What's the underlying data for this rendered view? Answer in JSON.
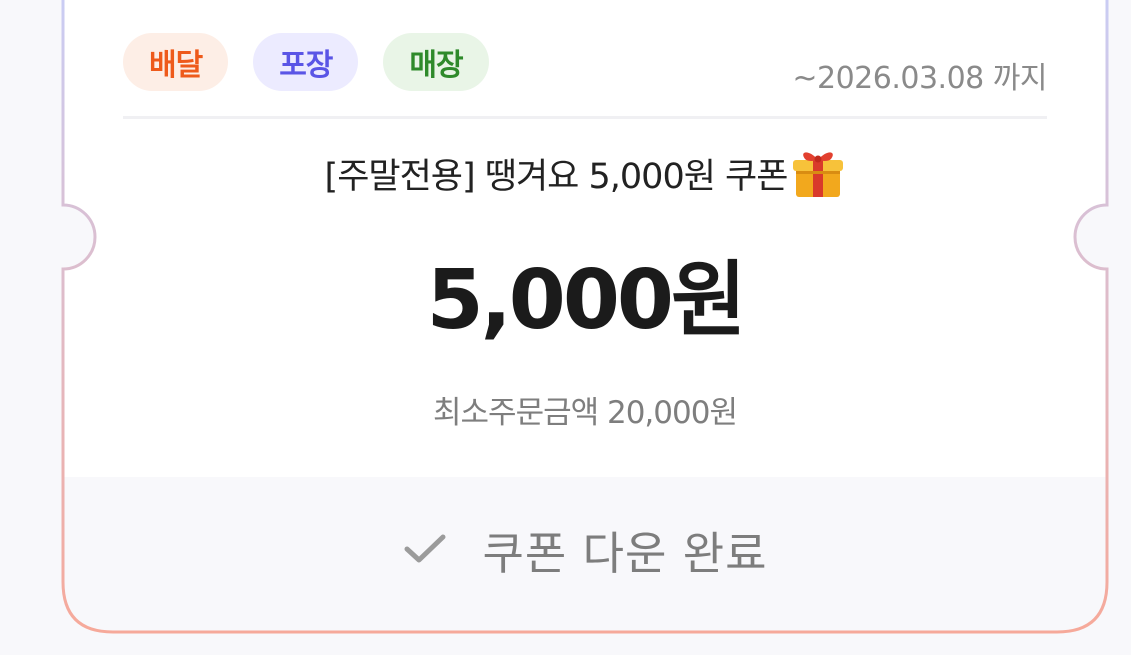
{
  "tags": [
    {
      "label": "배달",
      "color": "#ee5a1b",
      "background": "#fdeee6"
    },
    {
      "label": "포장",
      "color": "#5a55e6",
      "background": "#ecebff"
    },
    {
      "label": "매장",
      "color": "#2f8a2b",
      "background": "#e9f5e7"
    }
  ],
  "expiry": "~2026.03.08 까지",
  "coupon": {
    "title": "[주말전용] 땡겨요 5,000원 쿠폰",
    "title_icon": "gift-icon",
    "amount": "5,000원",
    "min_order": "최소주문금액 20,000원"
  },
  "download": {
    "label": "쿠폰 다운 완료",
    "icon": "check-icon",
    "completed": true
  },
  "colors": {
    "border_gradient_top": "#c9cdf5",
    "border_gradient_bottom": "#f6a99a",
    "footer_background": "#f8f8fb"
  }
}
